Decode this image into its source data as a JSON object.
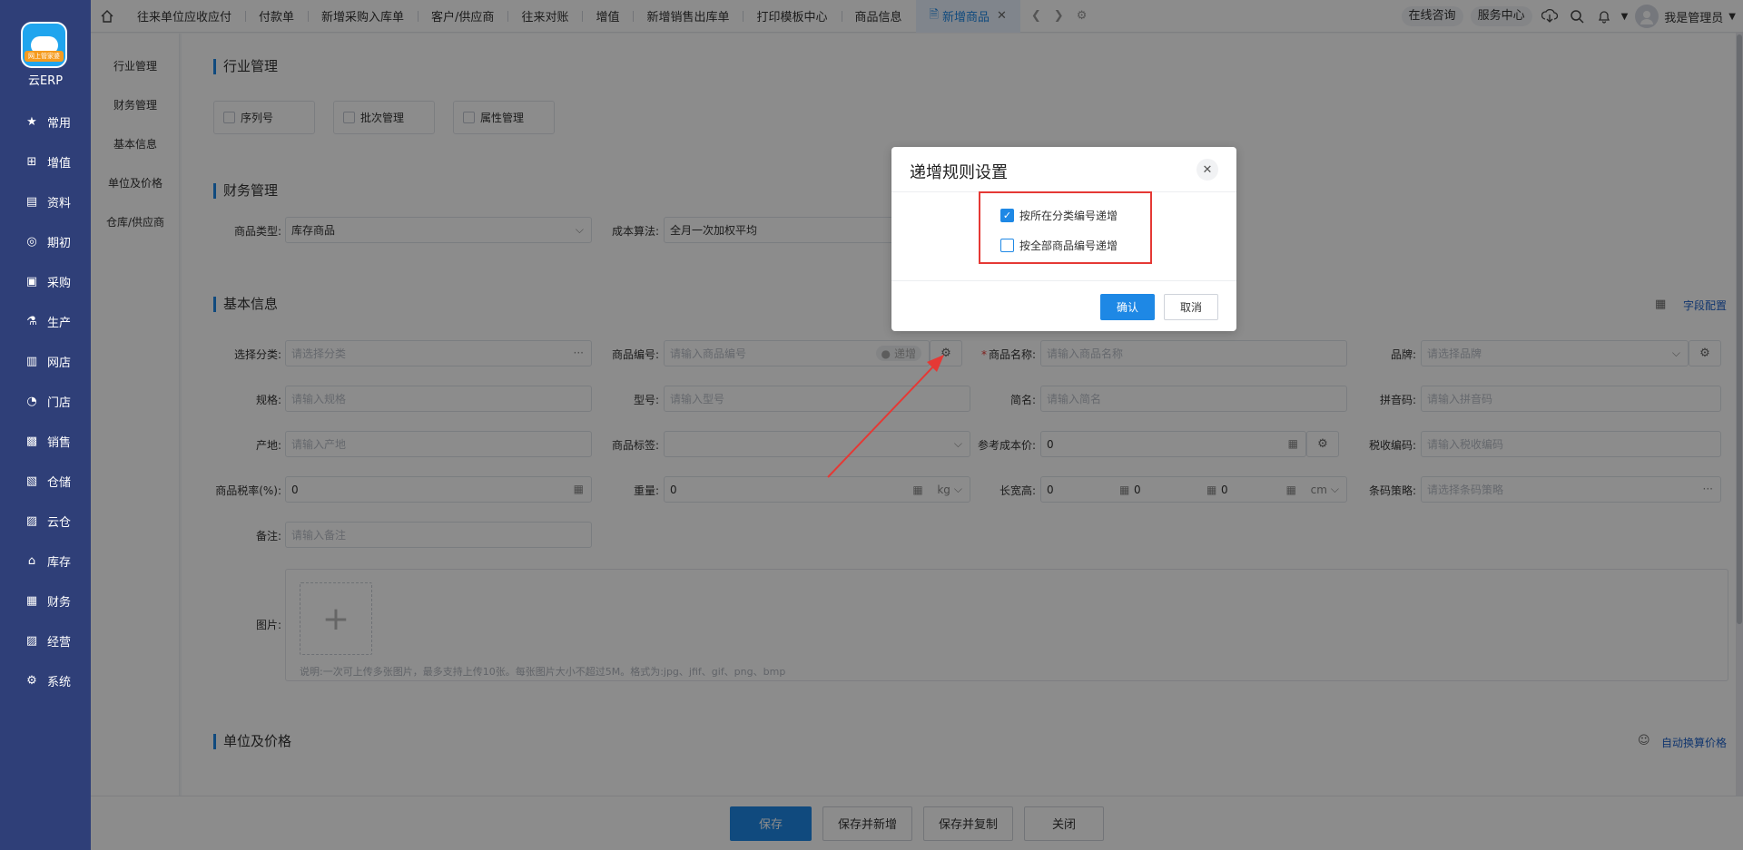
{
  "app": {
    "brand": "云ERP",
    "logo_badge": "网上管家婆"
  },
  "leftnav": [
    {
      "label": "常用",
      "icon": "star-icon"
    },
    {
      "label": "增值",
      "icon": "plus-square-icon"
    },
    {
      "label": "资料",
      "icon": "document-icon"
    },
    {
      "label": "期初",
      "icon": "target-icon"
    },
    {
      "label": "采购",
      "icon": "purchase-icon"
    },
    {
      "label": "生产",
      "icon": "production-icon"
    },
    {
      "label": "网店",
      "icon": "store-icon"
    },
    {
      "label": "门店",
      "icon": "pie-icon"
    },
    {
      "label": "销售",
      "icon": "chart-icon"
    },
    {
      "label": "仓储",
      "icon": "warehouse-icon"
    },
    {
      "label": "云仓",
      "icon": "cloud-warehouse-icon"
    },
    {
      "label": "库存",
      "icon": "home-stock-icon"
    },
    {
      "label": "财务",
      "icon": "finance-icon"
    },
    {
      "label": "经营",
      "icon": "business-icon"
    },
    {
      "label": "系统",
      "icon": "system-gear-icon"
    }
  ],
  "tabs": [
    {
      "label": "往来单位应收应付"
    },
    {
      "label": "付款单"
    },
    {
      "label": "新增采购入库单"
    },
    {
      "label": "客户/供应商"
    },
    {
      "label": "往来对账"
    },
    {
      "label": "增值"
    },
    {
      "label": "新增销售出库单"
    },
    {
      "label": "打印模板中心"
    },
    {
      "label": "商品信息"
    }
  ],
  "active_tab": "新增商品",
  "topright": {
    "consult": "在线咨询",
    "service": "服务中心",
    "user": "我是管理员"
  },
  "secnav": [
    "行业管理",
    "财务管理",
    "基本信息",
    "单位及价格",
    "仓库/供应商"
  ],
  "sections": {
    "industry": "行业管理",
    "finance": "财务管理",
    "basic": "基本信息",
    "unit_price": "单位及价格"
  },
  "industry_options": [
    "序列号",
    "批次管理",
    "属性管理"
  ],
  "finance_fields": {
    "goods_type_label": "商品类型:",
    "goods_type_value": "库存商品",
    "cost_method_label": "成本算法:",
    "cost_method_value": "全月一次加权平均"
  },
  "basic_fields": {
    "field_config": "字段配置",
    "category_label": "选择分类:",
    "category_ph": "请选择分类",
    "code_label": "商品编号:",
    "code_ph": "请输入商品编号",
    "code_increment": "递增",
    "name_label": "商品名称:",
    "name_ph": "请输入商品名称",
    "brand_label": "品牌:",
    "brand_ph": "请选择品牌",
    "spec_label": "规格:",
    "spec_ph": "请输入规格",
    "model_label": "型号:",
    "model_ph": "请输入型号",
    "short_label": "简名:",
    "short_ph": "请输入简名",
    "pinyin_label": "拼音码:",
    "pinyin_ph": "请输入拼音码",
    "origin_label": "产地:",
    "origin_ph": "请输入产地",
    "tag_label": "商品标签:",
    "refcost_label": "参考成本价:",
    "refcost_value": "0",
    "taxcode_label": "税收编码:",
    "taxcode_ph": "请输入税收编码",
    "taxrate_label": "商品税率(%):",
    "taxrate_value": "0",
    "weight_label": "重量:",
    "weight_value": "0",
    "weight_unit": "kg",
    "lwh_label": "长宽高:",
    "length_value": "0",
    "width_value": "0",
    "height_value": "0",
    "lwh_unit": "cm",
    "barcode_label": "条码策略:",
    "barcode_ph": "请选择条码策略",
    "remark_label": "备注:",
    "remark_ph": "请输入备注",
    "image_label": "图片:",
    "image_hint": "说明:一次可上传多张图片，最多支持上传10张。每张图片大小不超过5M。格式为:jpg、jfif、gif、png、bmp"
  },
  "unit_price": {
    "auto_convert": "自动换算价格"
  },
  "bottom_buttons": {
    "save": "保存",
    "save_new": "保存并新增",
    "save_copy": "保存并复制",
    "close": "关闭"
  },
  "dialog": {
    "title": "递增规则设置",
    "options": [
      {
        "label": "按所在分类编号递增",
        "checked": true
      },
      {
        "label": "按全部商品编号递增",
        "checked": false
      }
    ],
    "confirm": "确认",
    "cancel": "取消"
  },
  "colors": {
    "primary": "#1e88e5",
    "nav_bg": "#2f3f78",
    "highlight_red": "#e53935"
  }
}
